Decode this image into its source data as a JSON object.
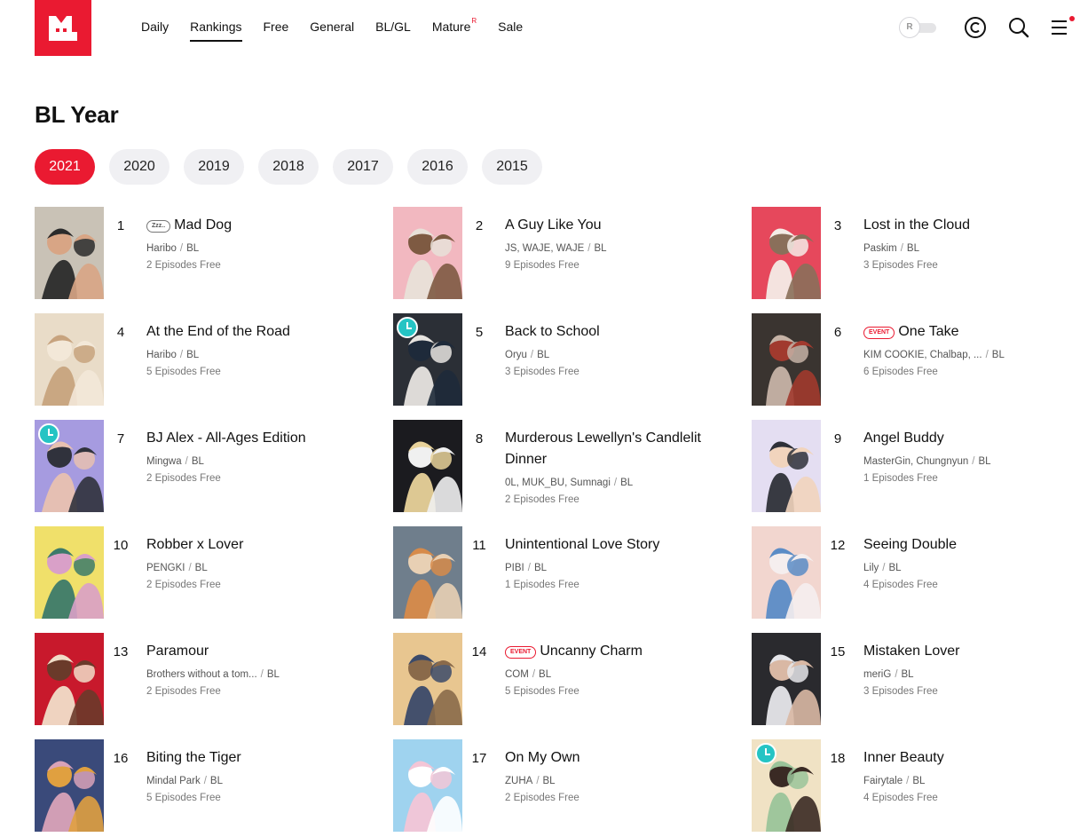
{
  "nav": {
    "items": [
      {
        "label": "Daily",
        "active": false,
        "sup": ""
      },
      {
        "label": "Rankings",
        "active": true,
        "sup": ""
      },
      {
        "label": "Free",
        "active": false,
        "sup": ""
      },
      {
        "label": "General",
        "active": false,
        "sup": ""
      },
      {
        "label": "BL/GL",
        "active": false,
        "sup": ""
      },
      {
        "label": "Mature",
        "active": false,
        "sup": "R"
      },
      {
        "label": "Sale",
        "active": false,
        "sup": ""
      }
    ],
    "toggle_label": "R"
  },
  "page": {
    "title": "BL Year"
  },
  "years": [
    {
      "label": "2021",
      "active": true
    },
    {
      "label": "2020",
      "active": false
    },
    {
      "label": "2019",
      "active": false
    },
    {
      "label": "2018",
      "active": false
    },
    {
      "label": "2017",
      "active": false
    },
    {
      "label": "2016",
      "active": false
    },
    {
      "label": "2015",
      "active": false
    }
  ],
  "theme": {
    "accent": "#ea1a31",
    "clock": "#25c4c4"
  },
  "comics": [
    {
      "rank": "1",
      "title": "Mad Dog",
      "badge": "Zzz..",
      "badge_type": "zzz",
      "author": "Haribo",
      "genre": "BL",
      "free": "2 Episodes Free",
      "clock": false,
      "palette": [
        "#c9c2b6",
        "#2b2b2b",
        "#d8a585"
      ]
    },
    {
      "rank": "2",
      "title": "A Guy Like You",
      "badge": "",
      "badge_type": "",
      "author": "JS, WAJE, WAJE",
      "genre": "BL",
      "free": "9 Episodes Free",
      "clock": false,
      "palette": [
        "#f2b8c0",
        "#e8e0d8",
        "#7e5a42"
      ]
    },
    {
      "rank": "3",
      "title": "Lost in the Cloud",
      "badge": "",
      "badge_type": "",
      "author": "Paskim",
      "genre": "BL",
      "free": "3 Episodes Free",
      "clock": false,
      "palette": [
        "#e6485c",
        "#f4ece6",
        "#8a6f5a"
      ]
    },
    {
      "rank": "4",
      "title": "At the End of the Road",
      "badge": "",
      "badge_type": "",
      "author": "Haribo",
      "genre": "BL",
      "free": "5 Episodes Free",
      "clock": false,
      "palette": [
        "#e9dcc8",
        "#c7a37e",
        "#f3e8d8"
      ]
    },
    {
      "rank": "5",
      "title": "Back to School",
      "badge": "",
      "badge_type": "",
      "author": "Oryu",
      "genre": "BL",
      "free": "3 Episodes Free",
      "clock": true,
      "palette": [
        "#2b2f36",
        "#e7e4e0",
        "#1e2a3a"
      ]
    },
    {
      "rank": "6",
      "title": "One Take",
      "badge": "EVENT",
      "badge_type": "event",
      "author": "KIM COOKIE, Chalbap, ...",
      "genre": "BL",
      "free": "6 Episodes Free",
      "clock": false,
      "palette": [
        "#3a3430",
        "#c6b3a6",
        "#a13a2e"
      ]
    },
    {
      "rank": "7",
      "title": "BJ Alex - All-Ages Edition",
      "badge": "",
      "badge_type": "",
      "author": "Mingwa",
      "genre": "BL",
      "free": "2 Episodes Free",
      "clock": true,
      "palette": [
        "#a69be0",
        "#e8c1b0",
        "#30323c"
      ]
    },
    {
      "rank": "8",
      "title": "Murderous Lewellyn's Candlelit Dinner",
      "badge": "",
      "badge_type": "",
      "author": "0L, MUK_BU, Sumnagi",
      "genre": "BL",
      "free": "2 Episodes Free",
      "clock": false,
      "palette": [
        "#1b1b1f",
        "#e8d29a",
        "#f0f0f0"
      ]
    },
    {
      "rank": "9",
      "title": "Angel Buddy",
      "badge": "",
      "badge_type": "",
      "author": "MasterGin, Chungnyun",
      "genre": "BL",
      "free": "1 Episodes Free",
      "clock": false,
      "palette": [
        "#e4def2",
        "#2e3038",
        "#f1d4bd"
      ]
    },
    {
      "rank": "10",
      "title": "Robber x Lover",
      "badge": "",
      "badge_type": "",
      "author": "PENGKI",
      "genre": "BL",
      "free": "2 Episodes Free",
      "clock": false,
      "palette": [
        "#f0e06a",
        "#3c7a6a",
        "#d9a0c8"
      ]
    },
    {
      "rank": "11",
      "title": "Unintentional Love Story",
      "badge": "",
      "badge_type": "",
      "author": "PIBI",
      "genre": "BL",
      "free": "1 Episodes Free",
      "clock": false,
      "palette": [
        "#6f7e8c",
        "#d78b4a",
        "#e8d0b4"
      ]
    },
    {
      "rank": "12",
      "title": "Seeing Double",
      "badge": "",
      "badge_type": "",
      "author": "Lily",
      "genre": "BL",
      "free": "4 Episodes Free",
      "clock": false,
      "palette": [
        "#f2d6cf",
        "#5b8cc6",
        "#f5eeee"
      ]
    },
    {
      "rank": "13",
      "title": "Paramour",
      "badge": "",
      "badge_type": "",
      "author": "Brothers without a tom...",
      "genre": "BL",
      "free": "2 Episodes Free",
      "clock": false,
      "palette": [
        "#c8192c",
        "#f1ddc8",
        "#6a3a2a"
      ]
    },
    {
      "rank": "14",
      "title": "Uncanny Charm",
      "badge": "EVENT",
      "badge_type": "event",
      "author": "COM",
      "genre": "BL",
      "free": "5 Episodes Free",
      "clock": false,
      "palette": [
        "#e8c690",
        "#3b4a6a",
        "#8a6a4a"
      ]
    },
    {
      "rank": "15",
      "title": "Mistaken Lover",
      "badge": "",
      "badge_type": "",
      "author": "meriG",
      "genre": "BL",
      "free": "3 Episodes Free",
      "clock": false,
      "palette": [
        "#2a2a2e",
        "#e6e6ea",
        "#d9b8a4"
      ]
    },
    {
      "rank": "16",
      "title": "Biting the Tiger",
      "badge": "",
      "badge_type": "",
      "author": "Mindal Park",
      "genre": "BL",
      "free": "5 Episodes Free",
      "clock": false,
      "palette": [
        "#3a4a7a",
        "#d9a2b8",
        "#e0a040"
      ]
    },
    {
      "rank": "17",
      "title": "On My Own",
      "badge": "",
      "badge_type": "",
      "author": "ZUHA",
      "genre": "BL",
      "free": "2 Episodes Free",
      "clock": false,
      "palette": [
        "#9fd3ef",
        "#f3c5d6",
        "#ffffff"
      ]
    },
    {
      "rank": "18",
      "title": "Inner Beauty",
      "badge": "",
      "badge_type": "",
      "author": "Fairytale",
      "genre": "BL",
      "free": "4 Episodes Free",
      "clock": true,
      "palette": [
        "#f0e2c4",
        "#9ac49a",
        "#3a2a24"
      ]
    }
  ]
}
